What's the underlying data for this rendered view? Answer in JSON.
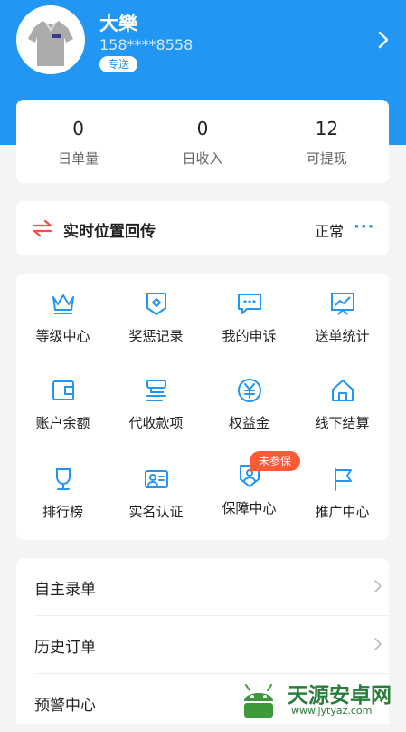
{
  "profile": {
    "name": "大樂",
    "phone": "158****8558",
    "tag": "专送"
  },
  "stats": [
    {
      "value": "0",
      "label": "日单量"
    },
    {
      "value": "0",
      "label": "日收入"
    },
    {
      "value": "12",
      "label": "可提现"
    }
  ],
  "location": {
    "label": "实时位置回传",
    "status": "正常",
    "more": "···"
  },
  "grid": {
    "items": [
      {
        "label": "等级中心",
        "icon": "crown-icon"
      },
      {
        "label": "奖惩记录",
        "icon": "shield-icon"
      },
      {
        "label": "我的申诉",
        "icon": "chat-icon"
      },
      {
        "label": "送单统计",
        "icon": "chart-icon"
      },
      {
        "label": "账户余额",
        "icon": "wallet-icon"
      },
      {
        "label": "代收款项",
        "icon": "receipt-icon"
      },
      {
        "label": "权益金",
        "icon": "yen-icon"
      },
      {
        "label": "线下结算",
        "icon": "house-icon"
      },
      {
        "label": "排行榜",
        "icon": "trophy-icon"
      },
      {
        "label": "实名认证",
        "icon": "id-card-icon"
      },
      {
        "label": "保障中心",
        "icon": "protection-icon"
      },
      {
        "label": "推广中心",
        "icon": "flag-icon"
      }
    ],
    "badge": "未参保"
  },
  "menu": {
    "items": [
      {
        "label": "自主录单"
      },
      {
        "label": "历史订单"
      },
      {
        "label": "预警中心"
      }
    ]
  },
  "watermark": {
    "title": "天源安卓网",
    "url": "www.jytyaz.com"
  },
  "colors": {
    "primary": "#2196f3",
    "badge": "#ff5a36",
    "background": "#f3f4f6",
    "accent_red": "#e8534a"
  }
}
